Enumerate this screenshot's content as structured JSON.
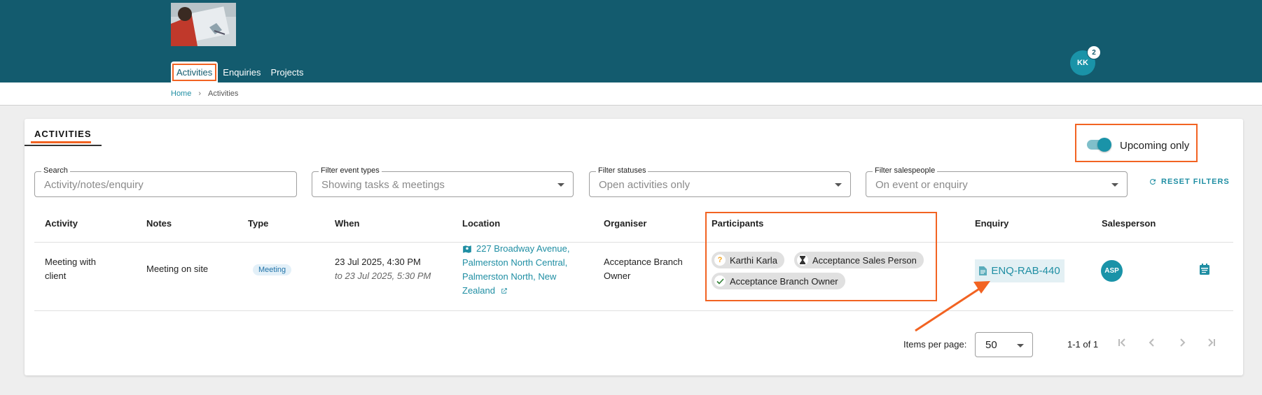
{
  "header": {
    "nav_tabs": [
      "Activities",
      "Enquiries",
      "Projects"
    ],
    "user_initials": "KK",
    "notification_count": "2"
  },
  "breadcrumb": {
    "home": "Home",
    "separator": "›",
    "current": "Activities"
  },
  "card": {
    "title": "ACTIVITIES",
    "upcoming_label": "Upcoming only",
    "upcoming_on": true
  },
  "filters": {
    "search": {
      "label": "Search",
      "placeholder": "Activity/notes/enquiry"
    },
    "event_types": {
      "label": "Filter event types",
      "value": "Showing tasks & meetings"
    },
    "statuses": {
      "label": "Filter statuses",
      "value": "Open activities only"
    },
    "salespeople": {
      "label": "Filter salespeople",
      "value": "On event or enquiry"
    },
    "reset_label": "RESET FILTERS"
  },
  "table": {
    "headers": [
      "Activity",
      "Notes",
      "Type",
      "When",
      "Location",
      "Organiser",
      "Participants",
      "Enquiry",
      "Salesperson"
    ],
    "rows": [
      {
        "activity": [
          "Meeting with",
          "client"
        ],
        "notes": "Meeting on site",
        "type": "Meeting",
        "when": "23 Jul 2025, 4:30 PM",
        "when_to": "to 23 Jul 2025, 5:30 PM",
        "location": [
          "227 Broadway Avenue,",
          "Palmerston North Central,",
          "Palmerston North, New",
          "Zealand"
        ],
        "organiser": [
          "Acceptance Branch",
          "Owner"
        ],
        "participants": [
          {
            "name": "Karthi Karla",
            "status_icon": "question-icon"
          },
          {
            "name": "Acceptance Sales Person",
            "status_icon": "hourglass-icon"
          },
          {
            "name": "Acceptance Branch Owner",
            "status_icon": "check-icon"
          }
        ],
        "enquiry": "ENQ-RAB-440",
        "salesperson": "ASP"
      }
    ]
  },
  "pagination": {
    "items_per_page_label": "Items per page:",
    "items_per_page": "50",
    "range": "1-1 of 1"
  },
  "colors": {
    "header_bg": "#135b6e",
    "accent": "#1f8ea3",
    "annotation": "#f26322"
  }
}
